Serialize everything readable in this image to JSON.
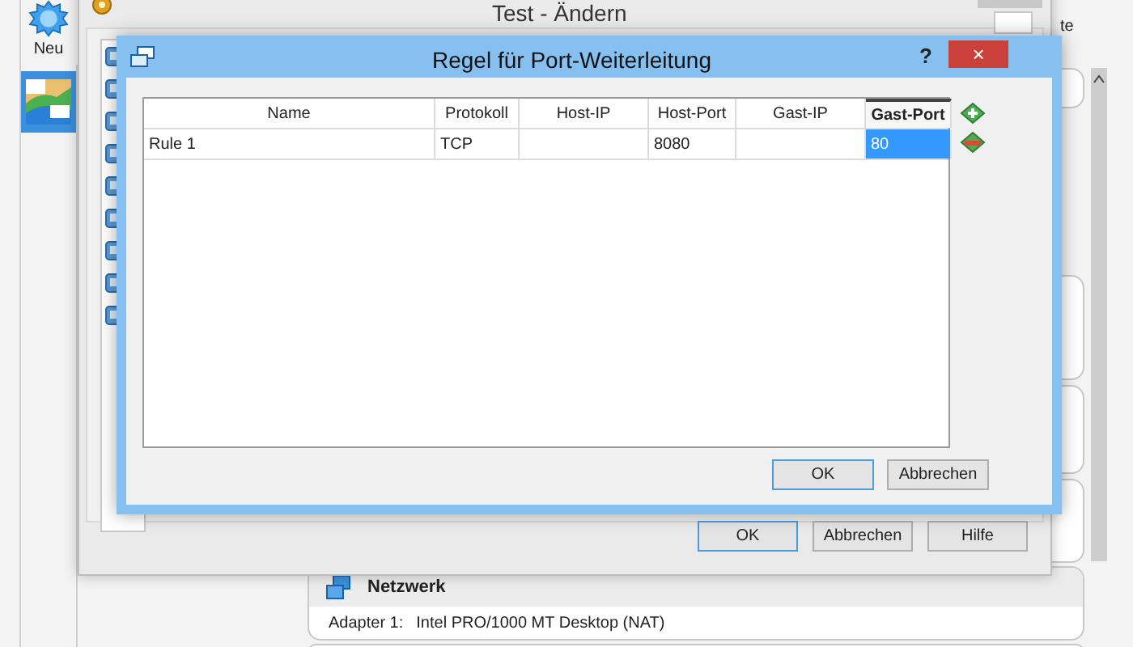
{
  "main_window": {
    "toolbar": [
      {
        "label": "Neu"
      }
    ],
    "vm_list": [
      {
        "selected": true
      }
    ],
    "side_text": "te",
    "network": {
      "title": "Netzwerk",
      "rows": [
        {
          "label": "Adapter 1:",
          "value": "Intel PRO/1000 MT Desktop (NAT)"
        }
      ]
    }
  },
  "settings_dialog": {
    "title": "Test - Ändern",
    "buttons": [
      {
        "label": "OK",
        "default": true
      },
      {
        "label": "Abbrechen",
        "default": false
      },
      {
        "label": "Hilfe",
        "default": false
      }
    ]
  },
  "port_dialog": {
    "title": "Regel für Port-Weiterleitung",
    "help": "?",
    "close": "×",
    "table": {
      "columns": [
        {
          "label": "Name",
          "selected": false
        },
        {
          "label": "Protokoll",
          "selected": false
        },
        {
          "label": "Host-IP",
          "selected": false
        },
        {
          "label": "Host-Port",
          "selected": false
        },
        {
          "label": "Gast-IP",
          "selected": false
        },
        {
          "label": "Gast-Port",
          "selected": true
        }
      ],
      "rows": [
        {
          "cells": [
            {
              "text": "Rule 1",
              "selected": false
            },
            {
              "text": "TCP",
              "selected": false
            },
            {
              "selected": false
            },
            {
              "text": "8080",
              "selected": false
            },
            {
              "selected": false
            },
            {
              "text": "80",
              "selected": true
            }
          ]
        }
      ]
    },
    "buttons": [
      {
        "label": "OK",
        "default": true
      },
      {
        "label": "Abbrechen",
        "default": false
      }
    ]
  }
}
